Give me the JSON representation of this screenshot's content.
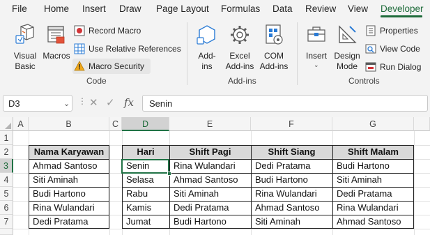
{
  "menu": {
    "tabs": [
      "File",
      "Home",
      "Insert",
      "Draw",
      "Page Layout",
      "Formulas",
      "Data",
      "Review",
      "View",
      "Developer"
    ],
    "active": "Developer"
  },
  "ribbon": {
    "code_group": {
      "label": "Code",
      "visual_basic": "Visual\nBasic",
      "macros": "Macros",
      "record_macro": "Record Macro",
      "use_relative": "Use Relative References",
      "macro_security": "Macro Security"
    },
    "addins_group": {
      "label": "Add-ins",
      "addins": "Add-\nins",
      "excel_addins": "Excel\nAdd-ins",
      "com_addins": "COM\nAdd-ins"
    },
    "controls_group": {
      "label": "Controls",
      "insert": "Insert",
      "design_mode": "Design\nMode",
      "properties": "Properties",
      "view_code": "View Code",
      "run_dialog": "Run Dialog"
    }
  },
  "formula_bar": {
    "name_box": "D3",
    "formula": "Senin"
  },
  "sheet": {
    "columns": [
      "A",
      "B",
      "C",
      "D",
      "E",
      "F",
      "G"
    ],
    "rows": [
      "1",
      "2",
      "3",
      "4",
      "5",
      "6",
      "7"
    ],
    "selected_column": "D",
    "selected_row": "3",
    "employee_table": {
      "header": "Nama Karyawan",
      "names": [
        "Ahmad Santoso",
        "Siti Aminah",
        "Budi Hartono",
        "Rina Wulandari",
        "Dedi Pratama"
      ]
    },
    "shift_table": {
      "headers": [
        "Hari",
        "Shift Pagi",
        "Shift Siang",
        "Shift Malam"
      ],
      "rows": [
        [
          "Senin",
          "Rina Wulandari",
          "Dedi Pratama",
          "Budi Hartono"
        ],
        [
          "Selasa",
          "Ahmad Santoso",
          "Budi Hartono",
          "Siti Aminah"
        ],
        [
          "Rabu",
          "Siti Aminah",
          "Rina Wulandari",
          "Dedi Pratama"
        ],
        [
          "Kamis",
          "Dedi Pratama",
          "Ahmad Santoso",
          "Rina Wulandari"
        ],
        [
          "Jumat",
          "Budi Hartono",
          "Siti Aminah",
          "Ahmad Santoso"
        ]
      ]
    }
  },
  "colors": {
    "accent": "#217346",
    "header_fill": "#d9d9d9",
    "ribbon_bg": "#f3f3f3"
  }
}
